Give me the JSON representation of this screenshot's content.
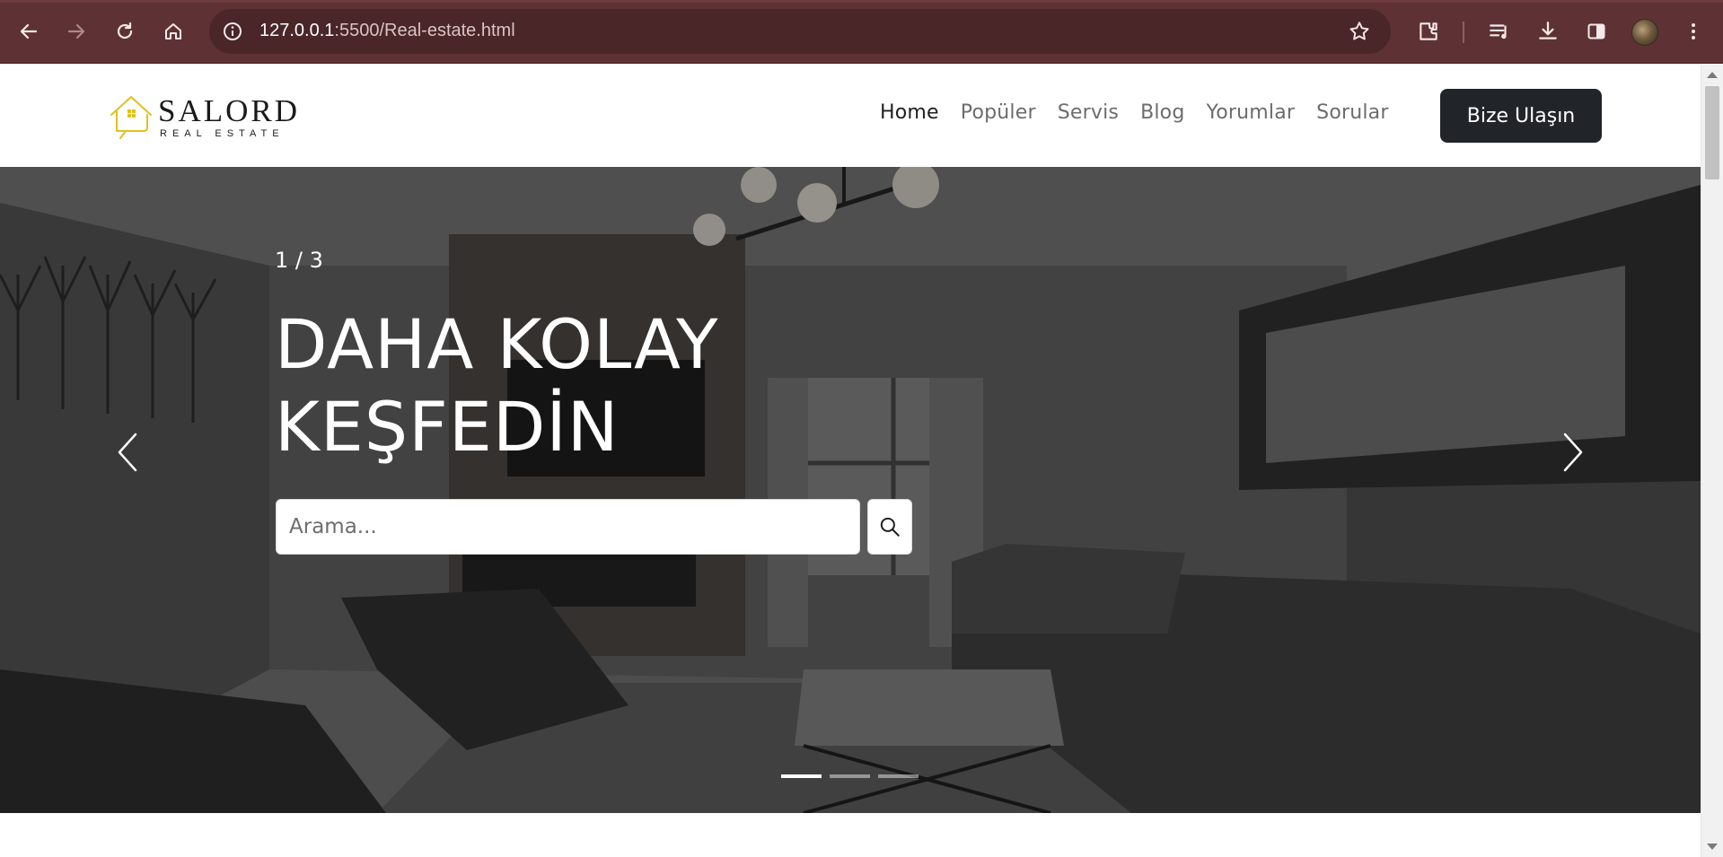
{
  "browser": {
    "url_host": "127.0.0.1",
    "url_rest": ":5500/Real-estate.html",
    "toolbar_icons": [
      "back-icon",
      "forward-icon",
      "reload-icon",
      "home-icon",
      "info-icon",
      "bookmark-star-icon",
      "extensions-icon",
      "media-queue-icon",
      "download-icon",
      "side-panel-icon",
      "profile-avatar",
      "menu-dots-icon"
    ]
  },
  "site": {
    "logo": {
      "brand": "SALORD",
      "tagline": "REAL ESTATE",
      "accent": "#e3c020"
    },
    "nav": {
      "items": [
        {
          "label": "Home",
          "active": true
        },
        {
          "label": "Popüler",
          "active": false
        },
        {
          "label": "Servis",
          "active": false
        },
        {
          "label": "Blog",
          "active": false
        },
        {
          "label": "Yorumlar",
          "active": false
        },
        {
          "label": "Sorular",
          "active": false
        }
      ],
      "cta": "Bize Ulaşın"
    },
    "hero": {
      "counter": "1 / 3",
      "title_line1": "DAHA KOLAY",
      "title_line2": "KEŞFEDİN",
      "search_placeholder": "Arama...",
      "slides_total": 3,
      "active_slide": 1
    }
  },
  "colors": {
    "browser_frame": "#5e3234",
    "omnibox": "#4a2628",
    "cta_bg": "#212529",
    "nav_text": "#6c6c6c",
    "nav_active": "#1f1f1f"
  }
}
